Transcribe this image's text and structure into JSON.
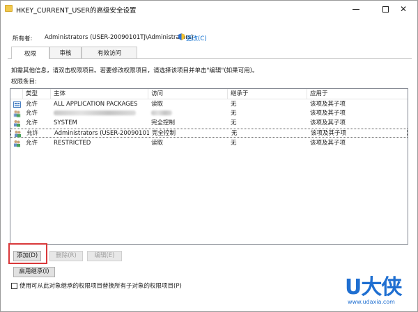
{
  "window": {
    "title": "HKEY_CURRENT_USER的高级安全设置",
    "controls": {
      "minimize": "—",
      "maximize": "",
      "close": "✕"
    }
  },
  "owner": {
    "label": "所有者:",
    "value": "Administrators (USER-20090101TJ\\Administrators)",
    "change_link": "更改(C)"
  },
  "tabs": [
    {
      "label": "权限",
      "active": true
    },
    {
      "label": "审核",
      "active": false
    },
    {
      "label": "有效访问",
      "active": false
    }
  ],
  "info_text": "如需其他信息，请双击权限项目。若要修改权限项目，请选择该项目并单击\"编辑\"(如果可用)。",
  "entries_label": "权限条目:",
  "table": {
    "columns": [
      "类型",
      "主体",
      "访问",
      "继承于",
      "应用于"
    ],
    "rows": [
      {
        "icon": "package-icon",
        "type": "允许",
        "principal": "ALL APPLICATION PACKAGES",
        "access": "读取",
        "inherited": "无",
        "applies": "该项及其子项",
        "blurred": false,
        "selected": false
      },
      {
        "icon": "users-icon",
        "type": "允许",
        "principal": "",
        "access": "",
        "inherited": "无",
        "applies": "该项及其子项",
        "blurred": true,
        "selected": false
      },
      {
        "icon": "users-icon",
        "type": "允许",
        "principal": "SYSTEM",
        "access": "完全控制",
        "inherited": "无",
        "applies": "该项及其子项",
        "blurred": false,
        "selected": false
      },
      {
        "icon": "users-icon",
        "type": "允许",
        "principal": "Administrators (USER-20090101...",
        "access": "完全控制",
        "inherited": "无",
        "applies": "该项及其子项",
        "blurred": false,
        "selected": true
      },
      {
        "icon": "users-icon",
        "type": "允许",
        "principal": "RESTRICTED",
        "access": "读取",
        "inherited": "无",
        "applies": "该项及其子项",
        "blurred": false,
        "selected": false
      }
    ]
  },
  "buttons": {
    "add": "添加(D)",
    "remove": "删除(R)",
    "edit": "编辑(E)",
    "enable_inheritance": "启用继承(I)"
  },
  "checkbox": {
    "label": "使用可从此对象继承的权限项目替换所有子对象的权限项目(P)",
    "checked": false
  },
  "watermark": {
    "brand": "U大侠",
    "url": "www.udaxia.com"
  },
  "colors": {
    "highlight": "#d9383a",
    "link": "#0066cc",
    "watermark": "#1f6fd1"
  }
}
